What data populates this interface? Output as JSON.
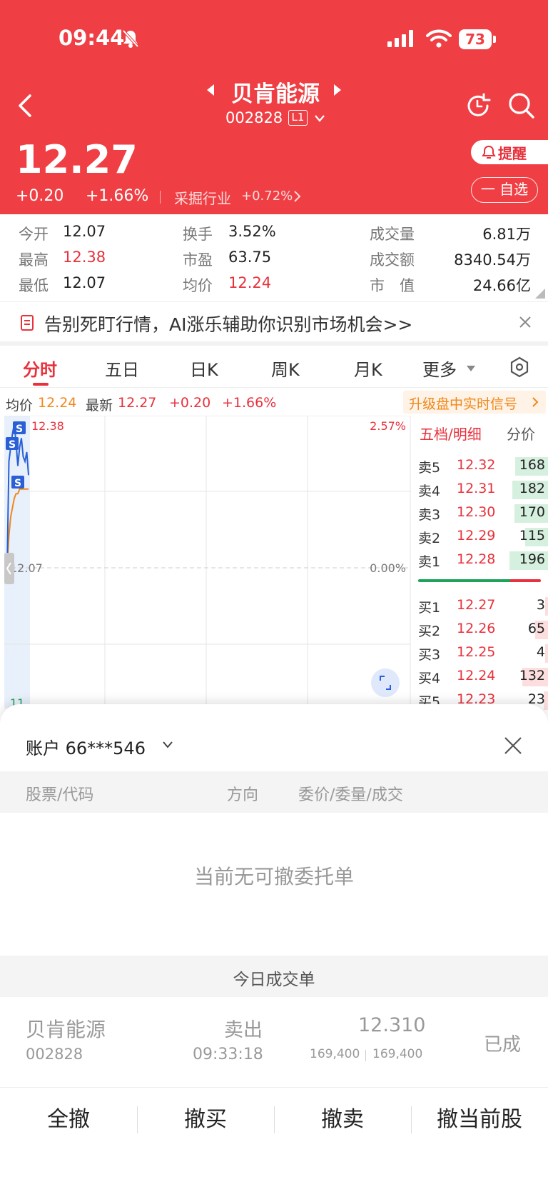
{
  "status_bar": {
    "time": "09:44",
    "battery": "73"
  },
  "header": {
    "stock_name": "贝肯能源",
    "stock_code": "002828",
    "level_badge": "L1",
    "price": "12.27",
    "change": "+0.20",
    "change_pct": "+1.66%",
    "industry": "采掘行业",
    "industry_pct": "+0.72%",
    "alert_label": "提醒",
    "watchlist_label": "一 自选"
  },
  "quote": [
    {
      "label": "今开",
      "value": "12.07"
    },
    {
      "label": "最高",
      "value": "12.38"
    },
    {
      "label": "最低",
      "value": "12.07"
    },
    {
      "label": "换手",
      "value": "3.52%"
    },
    {
      "label": "市盈",
      "value": "63.75"
    },
    {
      "label": "均价",
      "value": "12.24"
    },
    {
      "label": "成交量",
      "value": "6.81万"
    },
    {
      "label": "成交额",
      "value": "8340.54万"
    },
    {
      "label": "市　值",
      "value": "24.66亿"
    }
  ],
  "banner": {
    "text": "告别死盯行情，AI涨乐辅助你识别市场机会>>"
  },
  "tabs": [
    "分时",
    "五日",
    "日K",
    "周K",
    "月K",
    "更多"
  ],
  "chart_info": {
    "avg_label": "均价",
    "avg_value": "12.24",
    "latest_label": "最新",
    "latest_value": "12.27",
    "change": "+0.20",
    "change_pct": "+1.66%",
    "upgrade": "升级盘中实时信号"
  },
  "chart_data": {
    "type": "line",
    "top_price": "12.38",
    "top_pct": "2.57%",
    "base_price": "12.07",
    "base_pct": "0.00%",
    "bottom_price": "11.",
    "series": [
      {
        "values": [
          12.07,
          12.3,
          12.33,
          12.36,
          12.38,
          12.34,
          12.29,
          12.33,
          12.35,
          12.31,
          12.3,
          12.32,
          12.27
        ]
      },
      {
        "values": [
          12.07,
          12.14,
          12.18,
          12.2,
          12.22,
          12.23,
          12.23,
          12.24,
          12.24,
          12.24,
          12.24,
          12.24,
          12.24
        ]
      }
    ]
  },
  "orderbook": {
    "title": "五档/明细",
    "tab2": "分价",
    "sells": [
      {
        "label": "卖5",
        "price": "12.32",
        "vol": "168",
        "fill": 0.85
      },
      {
        "label": "卖4",
        "price": "12.31",
        "vol": "182",
        "fill": 0.93
      },
      {
        "label": "卖3",
        "price": "12.30",
        "vol": "170",
        "fill": 0.87
      },
      {
        "label": "卖2",
        "price": "12.29",
        "vol": "115",
        "fill": 0.59
      },
      {
        "label": "卖1",
        "price": "12.28",
        "vol": "196",
        "fill": 1.0
      }
    ],
    "buys": [
      {
        "label": "买1",
        "price": "12.27",
        "vol": "3",
        "fill": 0.02
      },
      {
        "label": "买2",
        "price": "12.26",
        "vol": "65",
        "fill": 0.33
      },
      {
        "label": "买3",
        "price": "12.25",
        "vol": "4",
        "fill": 0.02
      },
      {
        "label": "买4",
        "price": "12.24",
        "vol": "132",
        "fill": 0.67
      },
      {
        "label": "买5",
        "price": "12.23",
        "vol": "23",
        "fill": 0.12
      }
    ]
  },
  "sheet": {
    "account": "账户 66***546",
    "headers": [
      "股票/代码",
      "方向",
      "委价/委量/成交"
    ],
    "empty_text": "当前无可撤委托单",
    "today_title": "今日成交单",
    "trade": {
      "name": "贝肯能源",
      "code": "002828",
      "direction": "卖出",
      "time": "09:33:18",
      "price": "12.310",
      "qty": "169,400",
      "filled": "169,400",
      "status": "已成"
    },
    "buttons": [
      "全撤",
      "撤买",
      "撤卖",
      "撤当前股"
    ]
  }
}
